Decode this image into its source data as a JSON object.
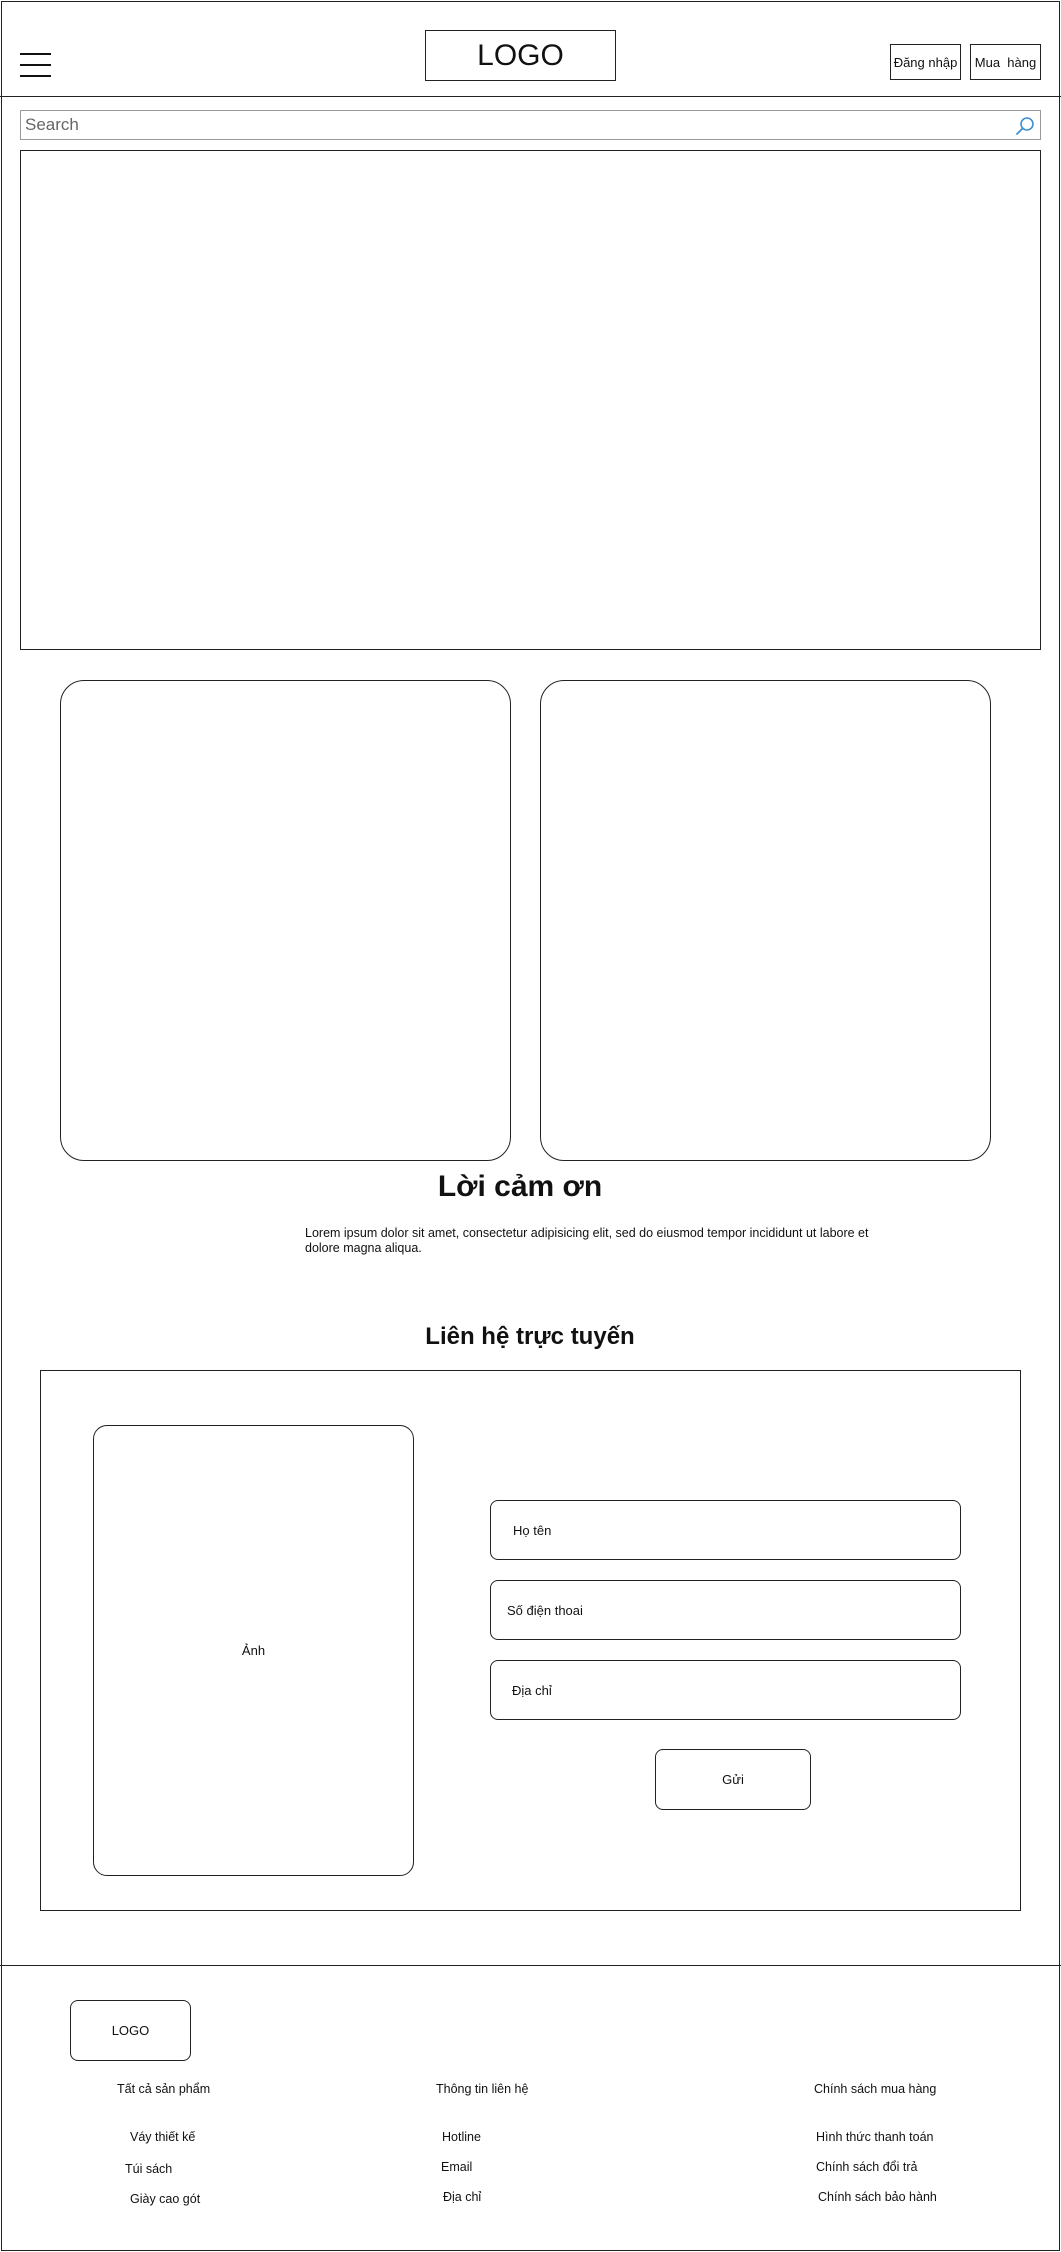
{
  "header": {
    "logo": "LOGO",
    "login_label": "Đăng nhập",
    "buy_label": "Mua  hàng"
  },
  "search": {
    "placeholder": "Search"
  },
  "thanks": {
    "title": "Lời cảm ơn",
    "body": "Lorem ipsum dolor sit amet, consectetur adipisicing elit, sed do eiusmod tempor incididunt ut labore et dolore magna aliqua."
  },
  "contact": {
    "title": "Liên hệ trực tuyến",
    "photo_label": "Ảnh",
    "name_label": "Họ tên",
    "phone_label": "Số điện thoai",
    "address_label": "Địa chỉ",
    "submit_label": "Gửi"
  },
  "footer": {
    "logo": "LOGO",
    "col1": {
      "heading": "Tất cả sản phẩm",
      "items": [
        "Váy thiết kế",
        "Túi sách",
        "Giày cao gót"
      ]
    },
    "col2": {
      "heading": "Thông tin liên hệ",
      "items": [
        "Hotline",
        "Email",
        "Địa chỉ"
      ]
    },
    "col3": {
      "heading": "Chính sách mua hàng",
      "items": [
        "Hình thức thanh toán",
        "Chính sách đổi trả",
        "Chính sách bảo hành"
      ]
    }
  }
}
